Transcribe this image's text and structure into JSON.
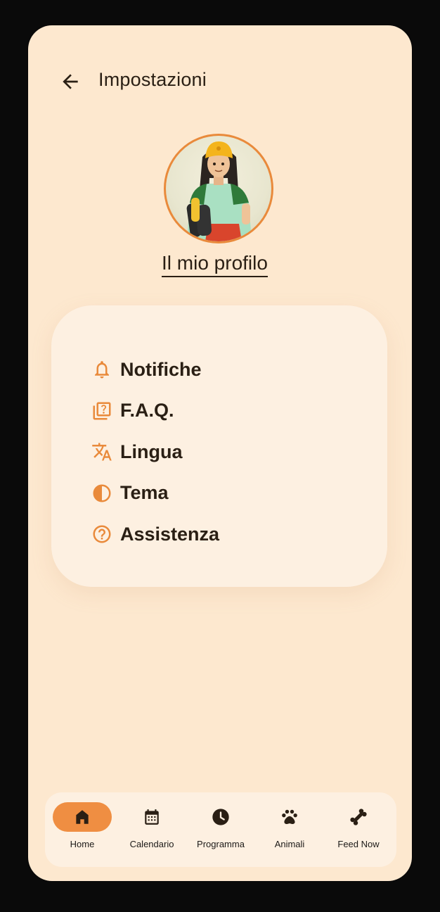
{
  "header": {
    "title": "Impostazioni",
    "back_icon": "arrow-back-icon"
  },
  "profile": {
    "link_label": "Il mio profilo",
    "avatar": "avatar-illustration"
  },
  "settings": {
    "items": [
      {
        "label": "Notifiche",
        "icon": "bell-icon"
      },
      {
        "label": "F.A.Q.",
        "icon": "faq-icon"
      },
      {
        "label": "Lingua",
        "icon": "translate-icon"
      },
      {
        "label": "Tema",
        "icon": "contrast-icon"
      },
      {
        "label": "Assistenza",
        "icon": "help-circle-icon"
      }
    ]
  },
  "navbar": {
    "items": [
      {
        "label": "Home",
        "icon": "home-icon",
        "active": true
      },
      {
        "label": "Calendario",
        "icon": "calendar-icon",
        "active": false
      },
      {
        "label": "Programma",
        "icon": "clock-icon",
        "active": false
      },
      {
        "label": "Animali",
        "icon": "paw-icon",
        "active": false
      },
      {
        "label": "Feed Now",
        "icon": "bone-icon",
        "active": false
      }
    ]
  },
  "colors": {
    "background": "#fde8cf",
    "card": "#fdf0e1",
    "accent": "#ef8e42",
    "text": "#2a1f14"
  }
}
